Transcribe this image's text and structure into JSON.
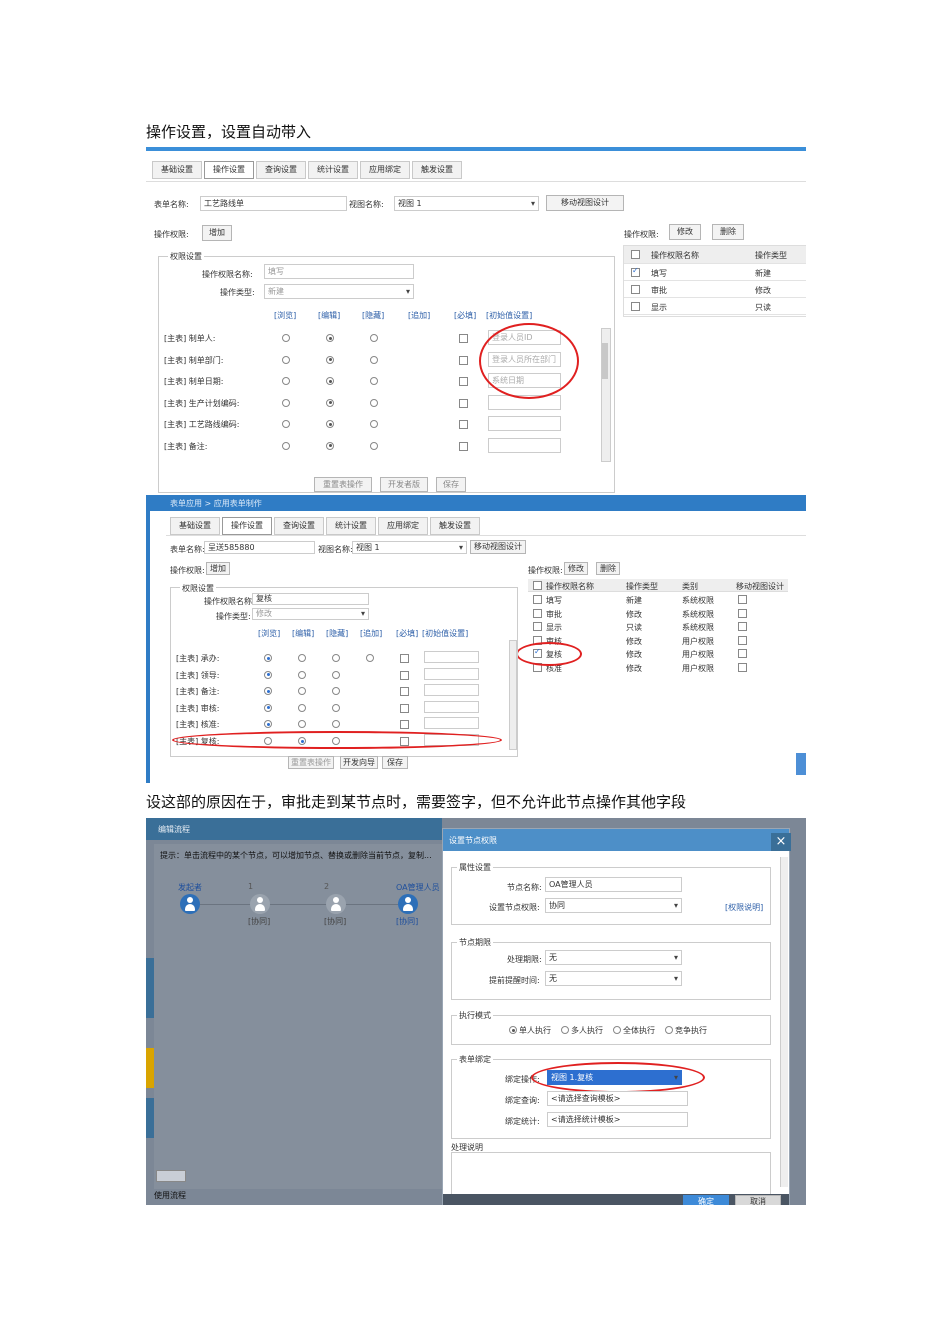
{
  "heading1": "操作设置，设置自动带入",
  "heading2": "设这部的原因在于，审批走到某节点时，需要签字，但不允许此节点操作其他字段",
  "shot1": {
    "tabs": [
      "基础设置",
      "操作设置",
      "查询设置",
      "统计设置",
      "应用绑定",
      "触发设置"
    ],
    "form_name_label": "表单名称:",
    "form_name_value": "工艺路线单",
    "view_name_label": "视图名称:",
    "view_name_value": "视图 1",
    "mobile_view_button": "移动视图设计",
    "op_perm_label": "操作权限:",
    "add_button": "增加",
    "edit_button": "修改",
    "delete_button": "删除",
    "perm_group_title": "权限设置",
    "perm_name_label": "操作权限名称:",
    "perm_name_value": "填写",
    "op_type_label": "操作类型:",
    "op_type_value": "新建",
    "columns": [
      "[浏览]",
      "[编辑]",
      "[隐藏]",
      "[追加]",
      "[必填]",
      "[初始值设置]"
    ],
    "fields": [
      {
        "label": "[主表] 制单人:",
        "init": "登录人员ID",
        "sel": 1
      },
      {
        "label": "[主表] 制单部门:",
        "init": "登录人员所在部门",
        "sel": 1
      },
      {
        "label": "[主表] 制单日期:",
        "init": "系统日期",
        "sel": 1
      },
      {
        "label": "[主表] 生产计划编码:",
        "init": "",
        "sel": 1
      },
      {
        "label": "[主表] 工艺路线编码:",
        "init": "",
        "sel": 1
      },
      {
        "label": "[主表] 备注:",
        "init": "",
        "sel": 1
      }
    ],
    "bottom_buttons": [
      "重置表操作",
      "开发者版",
      "保存"
    ],
    "right_table_header": [
      "操作权限名称",
      "操作类型"
    ],
    "right_table_rows": [
      {
        "name": "填写",
        "type": "新建",
        "checked": true
      },
      {
        "name": "审批",
        "type": "修改",
        "checked": false
      },
      {
        "name": "显示",
        "type": "只读",
        "checked": false
      }
    ]
  },
  "shot2": {
    "title": "表单应用 > 应用表单制作",
    "tabs": [
      "基础设置",
      "操作设置",
      "查询设置",
      "统计设置",
      "应用绑定",
      "触发设置"
    ],
    "form_name_label": "表单名称:",
    "form_name_value": "呈送585880",
    "view_name_label": "视图名称:",
    "view_name_value": "视图 1",
    "mobile_view_button": "移动视图设计",
    "op_perm_label": "操作权限:",
    "add_button": "增加",
    "edit_button": "修改",
    "delete_button": "删除",
    "perm_group_title": "权限设置",
    "perm_name_label": "操作权限名称:",
    "perm_name_value": "复核",
    "op_type_label": "操作类型:",
    "op_type_value": "修改",
    "columns": [
      "[浏览]",
      "[编辑]",
      "[隐藏]",
      "[追加]",
      "[必填]",
      "[初始值设置]"
    ],
    "fields": [
      {
        "label": "[主表] 承办:",
        "sel": 0
      },
      {
        "label": "[主表] 领导:",
        "sel": 0
      },
      {
        "label": "[主表] 备注:",
        "sel": 0
      },
      {
        "label": "[主表] 审核:",
        "sel": 0
      },
      {
        "label": "[主表] 核准:",
        "sel": 0
      },
      {
        "label": "[主表] 复核:",
        "sel": 1
      }
    ],
    "bottom_buttons": [
      "重置表操作",
      "开发向导",
      "保存"
    ],
    "right_table_header": [
      "操作权限名称",
      "操作类型",
      "类别",
      "移动视图设计"
    ],
    "right_table_rows": [
      {
        "name": "填写",
        "type": "新建",
        "cat": "系统权限",
        "checked": false
      },
      {
        "name": "审批",
        "type": "修改",
        "cat": "系统权限",
        "checked": false
      },
      {
        "name": "显示",
        "type": "只读",
        "cat": "系统权限",
        "checked": false
      },
      {
        "name": "审核",
        "type": "修改",
        "cat": "用户权限",
        "checked": false
      },
      {
        "name": "复核",
        "type": "修改",
        "cat": "用户权限",
        "checked": true
      },
      {
        "name": "核准",
        "type": "修改",
        "cat": "用户权限",
        "checked": false
      }
    ]
  },
  "shot3": {
    "left_title": "编辑流程",
    "tip": "提示：单击流程中的某个节点，可以增加节点、替换或删除当前节点，复制...",
    "nodes": [
      {
        "name": "发起者",
        "sub": ""
      },
      {
        "name": "1",
        "sub": "[协同]"
      },
      {
        "name": "2",
        "sub": "[协同]"
      },
      {
        "name": "OA管理人员",
        "sub": "[协同]"
      }
    ],
    "bottom_link": "使用流程",
    "dialog_title": "设置节点权限",
    "close_icon": "×",
    "attr_group": "属性设置",
    "node_name_label": "节点名称:",
    "node_name_value": "OA管理人员",
    "node_perm_label": "设置节点权限:",
    "node_perm_value": "协同",
    "perm_desc_link": "[权限说明]",
    "deadline_group": "节点期限",
    "deadline_label": "处理期限:",
    "deadline_value": "无",
    "remind_label": "提前提醒时间:",
    "remind_value": "无",
    "exec_group": "执行模式",
    "exec_modes": [
      "单人执行",
      "多人执行",
      "全体执行",
      "竞争执行"
    ],
    "bind_group": "表单绑定",
    "bind_op_label": "绑定操作:",
    "bind_op_value": "视图 1.复核",
    "bind_query_label": "绑定查询:",
    "bind_query_value": "<请选择查询模板>",
    "bind_stat_label": "绑定统计:",
    "bind_stat_value": "<请选择统计模板>",
    "desc_label": "处理说明",
    "ok_button": "确定",
    "cancel_button": "取消"
  }
}
